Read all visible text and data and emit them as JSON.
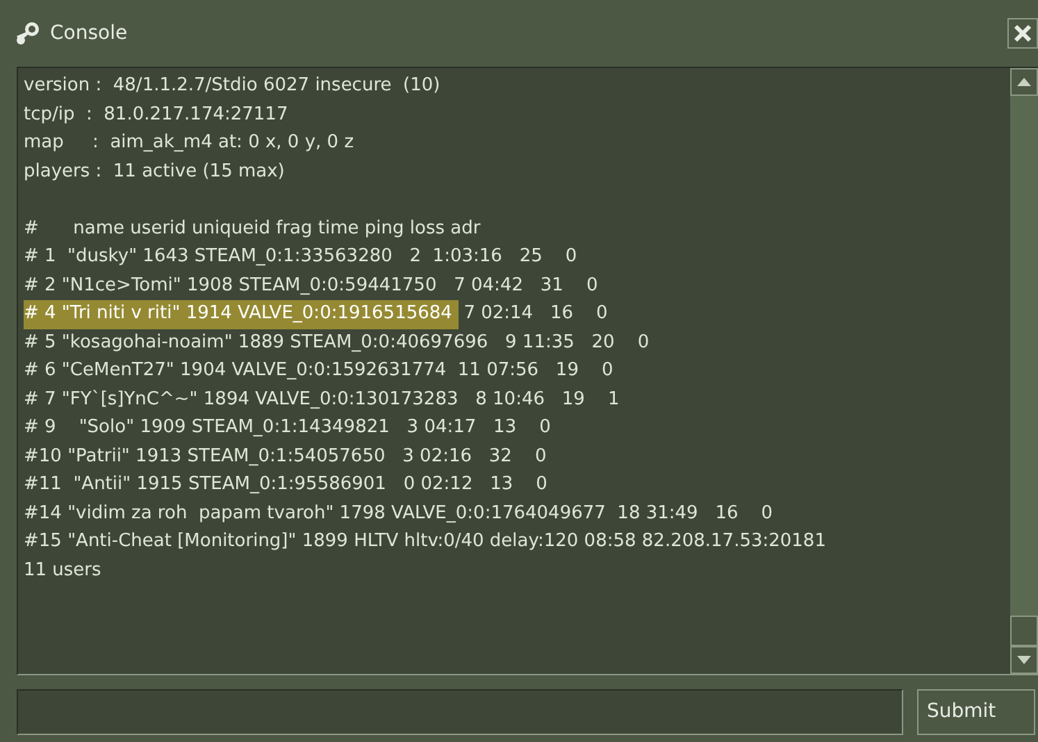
{
  "window": {
    "title": "Console"
  },
  "console": {
    "lines": [
      {
        "kind": "text",
        "text": "version :  48/1.1.2.7/Stdio 6027 insecure  (10)",
        "selected": false
      },
      {
        "kind": "text",
        "text": "tcp/ip  :  81.0.217.174:27117",
        "selected": false
      },
      {
        "kind": "text",
        "text": "map     :  aim_ak_m4 at: 0 x, 0 y, 0 z",
        "selected": false
      },
      {
        "kind": "text",
        "text": "players :  11 active (15 max)",
        "selected": false
      },
      {
        "kind": "blank"
      },
      {
        "kind": "text",
        "text": "#      name userid uniqueid frag time ping loss adr",
        "selected": false
      },
      {
        "kind": "text",
        "text": "# 1  \"dusky\" 1643 STEAM_0:1:33563280   2  1:03:16   25    0",
        "selected": false
      },
      {
        "kind": "text",
        "text": "# 2 \"N1ce>Tomi\" 1908 STEAM_0:0:59441750   7 04:42   31    0",
        "selected": false
      },
      {
        "kind": "text",
        "text": "# 4 \"Tri niti v riti\" 1914 VALVE_0:0:1916515684 ",
        "rest": " 7 02:14   16    0",
        "selected": true
      },
      {
        "kind": "text",
        "text": "# 5 \"kosagohai-noaim\" 1889 STEAM_0:0:40697696   9 11:35   20    0",
        "selected": false
      },
      {
        "kind": "text",
        "text": "# 6 \"CeMenT27\" 1904 VALVE_0:0:1592631774  11 07:56   19    0",
        "selected": false
      },
      {
        "kind": "text",
        "text": "# 7 \"FY`[s]YnC^~\" 1894 VALVE_0:0:130173283   8 10:46   19    1",
        "selected": false
      },
      {
        "kind": "text",
        "text": "# 9    \"Solo\" 1909 STEAM_0:1:14349821   3 04:17   13    0",
        "selected": false
      },
      {
        "kind": "text",
        "text": "#10 \"Patrii\" 1913 STEAM_0:1:54057650   3 02:16   32    0",
        "selected": false
      },
      {
        "kind": "text",
        "text": "#11  \"Antii\" 1915 STEAM_0:1:95586901   0 02:12   13    0",
        "selected": false
      },
      {
        "kind": "text",
        "text": "#14 \"vidim za roh  papam tvaroh\" 1798 VALVE_0:0:1764049677  18 31:49   16    0",
        "selected": false
      },
      {
        "kind": "text",
        "text": "#15 \"Anti-Cheat [Monitoring]\" 1899 HLTV hltv:0/40 delay:120 08:58 82.208.17.53:20181",
        "selected": false
      },
      {
        "kind": "text",
        "text": "11 users",
        "selected": false
      }
    ]
  },
  "submit": {
    "label": "Submit"
  }
}
